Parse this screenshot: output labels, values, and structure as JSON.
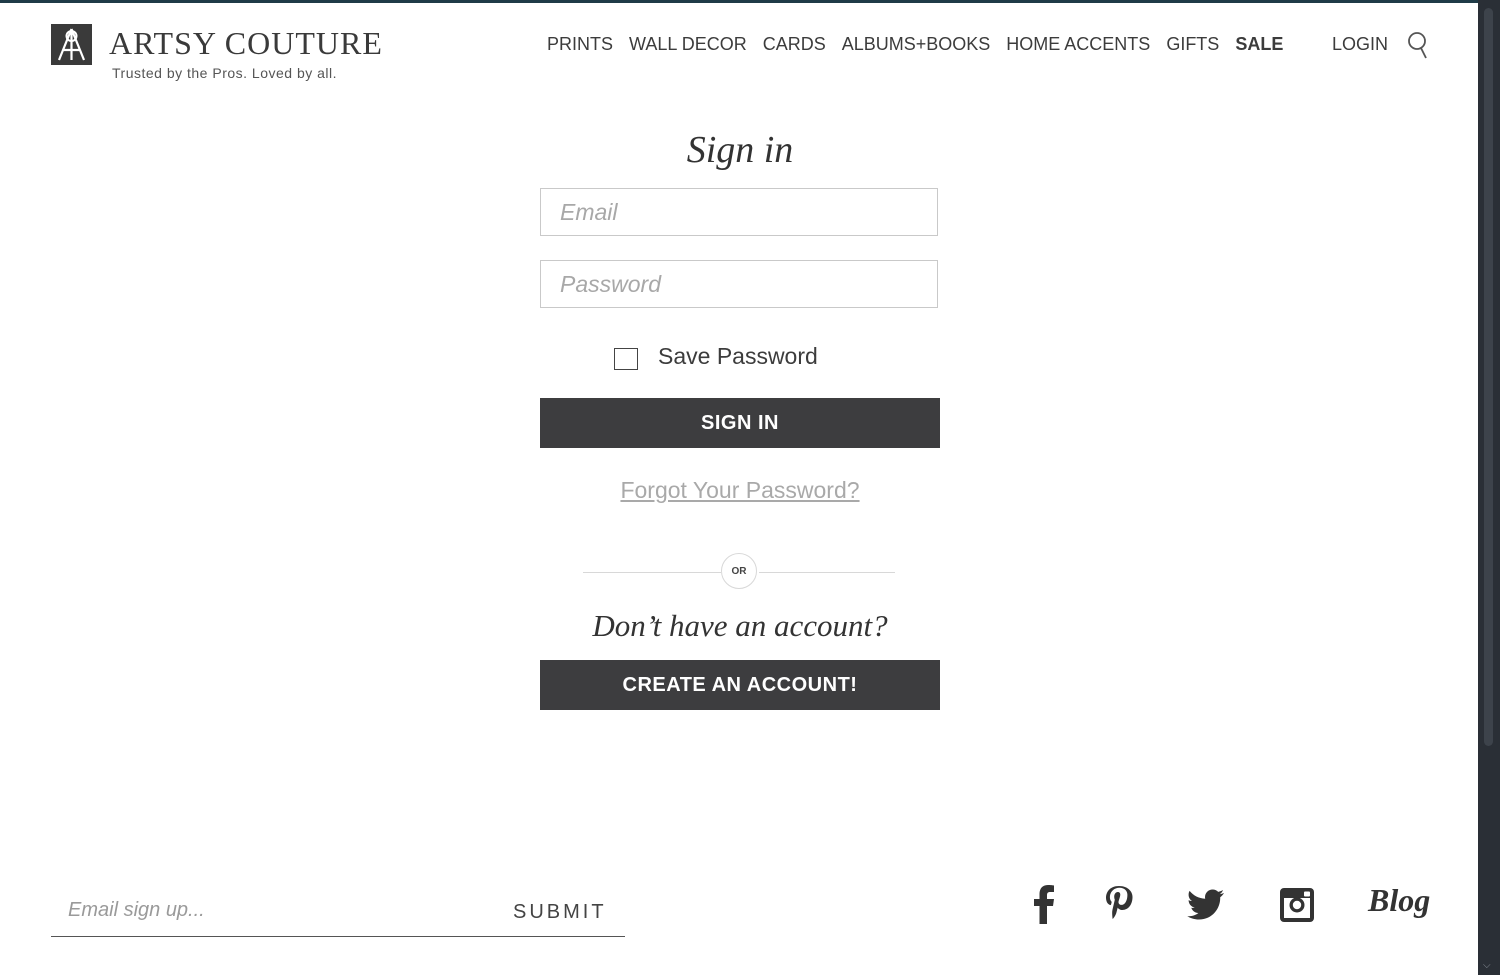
{
  "header": {
    "brand": "ARTSY COUTURE",
    "tagline": "Trusted by the Pros. Loved by all.",
    "nav": [
      "PRINTS",
      "WALL DECOR",
      "CARDS",
      "ALBUMS+BOOKS",
      "HOME ACCENTS",
      "GIFTS",
      "SALE"
    ],
    "login": "LOGIN",
    "search_icon": "search-icon"
  },
  "form": {
    "title": "Sign in",
    "email_placeholder": "Email",
    "password_placeholder": "Password",
    "save_password": "Save Password",
    "signin_button": "SIGN IN",
    "forgot_link": "Forgot Your Password?",
    "or": "OR",
    "no_account": "Don’t have an account?",
    "create_button": "CREATE AN ACCOUNT!"
  },
  "footer": {
    "newsletter_placeholder": "Email sign up...",
    "submit": "SUBMIT",
    "social": [
      "facebook-icon",
      "pinterest-icon",
      "twitter-icon",
      "instagram-icon"
    ],
    "blog": "Blog"
  },
  "colors": {
    "button": "#3d3d3f",
    "topline": "#1f3b47",
    "link_muted": "#a9a9a9"
  }
}
